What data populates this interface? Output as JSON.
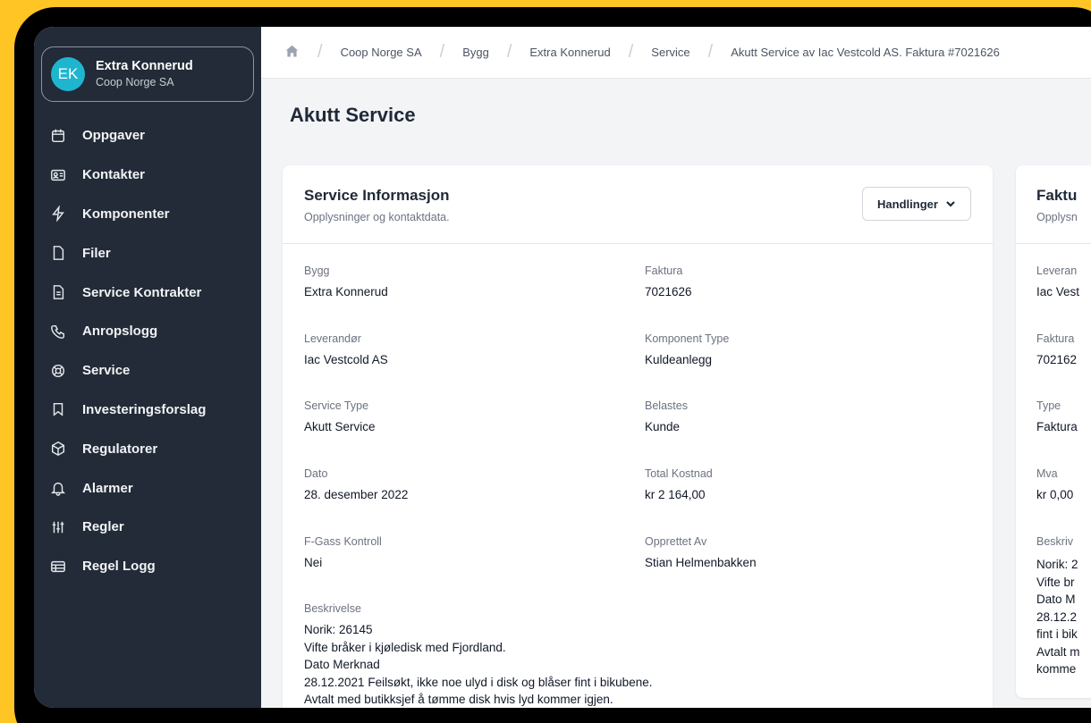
{
  "sidebar": {
    "avatar_initials": "EK",
    "account_name": "Extra Konnerud",
    "account_org": "Coop Norge SA",
    "items": [
      {
        "label": "Oppgaver",
        "icon": "calendar-icon"
      },
      {
        "label": "Kontakter",
        "icon": "contact-card-icon"
      },
      {
        "label": "Komponenter",
        "icon": "bolt-icon"
      },
      {
        "label": "Filer",
        "icon": "file-icon"
      },
      {
        "label": "Service Kontrakter",
        "icon": "document-icon"
      },
      {
        "label": "Anropslogg",
        "icon": "phone-icon"
      },
      {
        "label": "Service",
        "icon": "lifebuoy-icon"
      },
      {
        "label": "Investeringsforslag",
        "icon": "bookmark-icon"
      },
      {
        "label": "Regulatorer",
        "icon": "cube-icon"
      },
      {
        "label": "Alarmer",
        "icon": "bell-icon"
      },
      {
        "label": "Regler",
        "icon": "sliders-icon"
      },
      {
        "label": "Regel Logg",
        "icon": "table-icon"
      }
    ]
  },
  "breadcrumb": [
    "Coop Norge SA",
    "Bygg",
    "Extra Konnerud",
    "Service",
    "Akutt Service av Iac Vestcold AS. Faktura #7021626"
  ],
  "page_title": "Akutt Service",
  "service_card": {
    "title": "Service Informasjon",
    "subtitle": "Opplysninger og kontaktdata.",
    "actions_label": "Handlinger",
    "fields": {
      "bygg": {
        "label": "Bygg",
        "value": "Extra Konnerud"
      },
      "faktura": {
        "label": "Faktura",
        "value": "7021626"
      },
      "leverandor": {
        "label": "Leverandør",
        "value": "Iac Vestcold AS"
      },
      "komponent_type": {
        "label": "Komponent Type",
        "value": "Kuldeanlegg"
      },
      "service_type": {
        "label": "Service Type",
        "value": "Akutt Service"
      },
      "belastes": {
        "label": "Belastes",
        "value": "Kunde"
      },
      "dato": {
        "label": "Dato",
        "value": "28. desember 2022"
      },
      "total_kostnad": {
        "label": "Total Kostnad",
        "value": "kr 2 164,00"
      },
      "fgass": {
        "label": "F-Gass Kontroll",
        "value": "Nei"
      },
      "opprettet_av": {
        "label": "Opprettet Av",
        "value": "Stian Helmenbakken"
      }
    },
    "description": {
      "label": "Beskrivelse",
      "lines": [
        "Norik: 26145",
        "Vifte bråker i kjøledisk med Fjordland.",
        "Dato Merknad",
        "28.12.2021 Feilsøkt, ikke noe ulyd i disk og blåser fint i bikubene.",
        "Avtalt med butikksjef å tømme disk hvis lyd kommer igjen."
      ]
    }
  },
  "invoice_card": {
    "title": "Faktu",
    "subtitle": "Opplysn",
    "fields": [
      {
        "label": "Leveran",
        "value": "Iac Vest"
      },
      {
        "label": "Faktura",
        "value": "702162"
      },
      {
        "label": "Type",
        "value": "Faktura"
      },
      {
        "label": "Mva",
        "value": "kr 0,00"
      }
    ],
    "description": {
      "label": "Beskriv",
      "lines": [
        "Norik: 2",
        "Vifte br",
        "Dato M",
        "28.12.2",
        "fint i bik",
        "Avtalt m",
        "komme"
      ]
    }
  },
  "colors": {
    "background": "#ffc524",
    "sidebar": "#222b37",
    "avatar": "#1fb5cf"
  }
}
